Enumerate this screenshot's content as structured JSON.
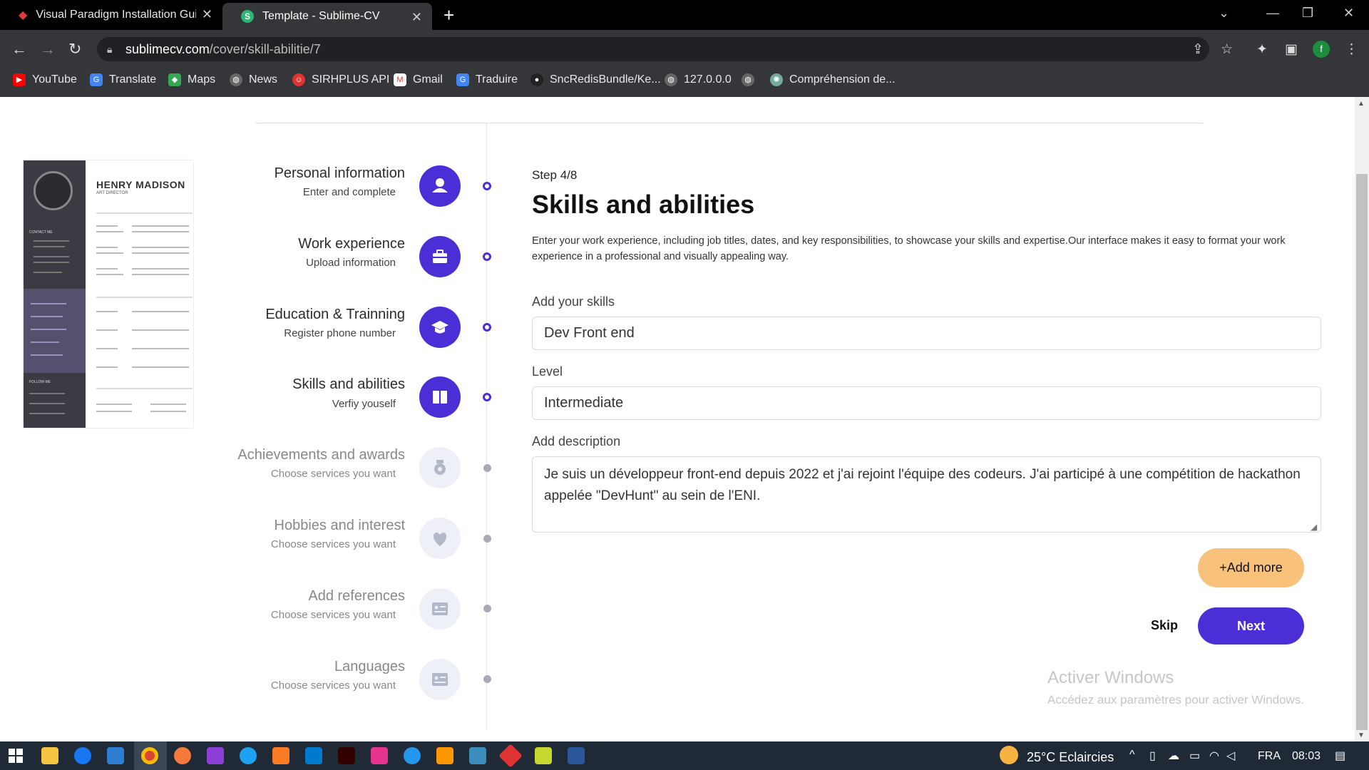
{
  "browser": {
    "tabs": [
      {
        "label": "Visual Paradigm Installation Guid",
        "active": false
      },
      {
        "label": "Template - Sublime-CV",
        "active": true
      }
    ],
    "url_domain": "sublimecv.com",
    "url_path": "/cover/skill-abilitie/7",
    "profile_initial": "f",
    "bookmarks": [
      "YouTube",
      "Translate",
      "Maps",
      "News",
      "SIRHPLUS API",
      "Gmail",
      "Traduire",
      "SncRedisBundle/Ke...",
      "127.0.0.0",
      "",
      "Compréhension de..."
    ]
  },
  "resume": {
    "name": "HENRY MADISON",
    "role": "ART DIRECTOR"
  },
  "steps": [
    {
      "title": "Personal information",
      "subtitle": "Enter and complete",
      "active": true
    },
    {
      "title": "Work experience",
      "subtitle": "Upload information",
      "active": true
    },
    {
      "title": "Education & Trainning",
      "subtitle": "Register phone number",
      "active": true
    },
    {
      "title": "Skills and abilities",
      "subtitle": "Verfiy youself",
      "active": true
    },
    {
      "title": "Achievements and awards",
      "subtitle": "Choose services you want",
      "active": false
    },
    {
      "title": "Hobbies and interest",
      "subtitle": "Choose services you want",
      "active": false
    },
    {
      "title": "Add references",
      "subtitle": "Choose services you want",
      "active": false
    },
    {
      "title": "Languages",
      "subtitle": "Choose services you want",
      "active": false
    }
  ],
  "form": {
    "step_label": "Step 4/8",
    "title": "Skills and abilities",
    "intro": "Enter your work experience, including job titles, dates, and key responsibilities, to showcase your skills and expertise.Our interface makes it easy to format your work experience in a professional and visually appealing way.",
    "skills_label": "Add your skills",
    "skills_value": "Dev Front end",
    "level_label": "Level",
    "level_value": "Intermediate",
    "description_label": "Add description",
    "description_value": "Je suis un développeur front-end depuis 2022 et j'ai rejoint l'équipe des codeurs. J'ai participé à une compétition de hackathon appelée \"DevHunt\" au sein de l'ENI.",
    "add_more_label": "+Add more",
    "skip_label": "Skip",
    "next_label": "Next"
  },
  "watermark": {
    "line1": "Activer Windows",
    "line2": "Accédez aux paramètres pour activer Windows."
  },
  "taskbar": {
    "weather": "25°C  Eclaircies",
    "language": "FRA",
    "time": "08:03"
  },
  "colors": {
    "accent": "#4b2ed6",
    "add_more": "#f8c27b"
  }
}
